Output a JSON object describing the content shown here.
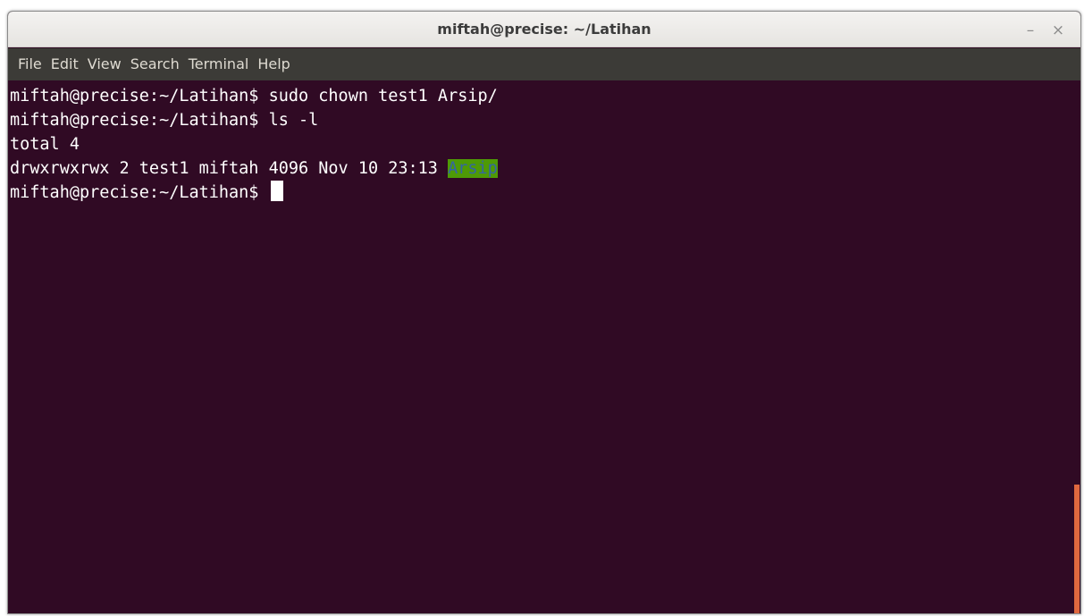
{
  "window": {
    "title": "miftah@precise: ~/Latihan",
    "minimize_glyph": "–",
    "close_glyph": "×"
  },
  "menubar": {
    "items": [
      {
        "label": "File"
      },
      {
        "label": "Edit"
      },
      {
        "label": "View"
      },
      {
        "label": "Search"
      },
      {
        "label": "Terminal"
      },
      {
        "label": "Help"
      }
    ]
  },
  "terminal": {
    "lines": [
      {
        "text": "miftah@precise:~/Latihan$ sudo chown test1 Arsip/"
      },
      {
        "text": "miftah@precise:~/Latihan$ ls -l"
      },
      {
        "text": "total 4"
      },
      {
        "text": "drwxrwxrwx 2 test1 miftah 4096 Nov 10 23:13 ",
        "dir": "Arsip"
      },
      {
        "text": "miftah@precise:~/Latihan$ "
      }
    ]
  },
  "colors": {
    "terminal_bg": "#300a24",
    "terminal_fg": "#ffffff",
    "dir_highlight_bg": "#4e9a06",
    "dir_highlight_fg": "#3465a4",
    "menubar_bg": "#3c3b37",
    "scrollbar_accent": "#e0683f"
  }
}
